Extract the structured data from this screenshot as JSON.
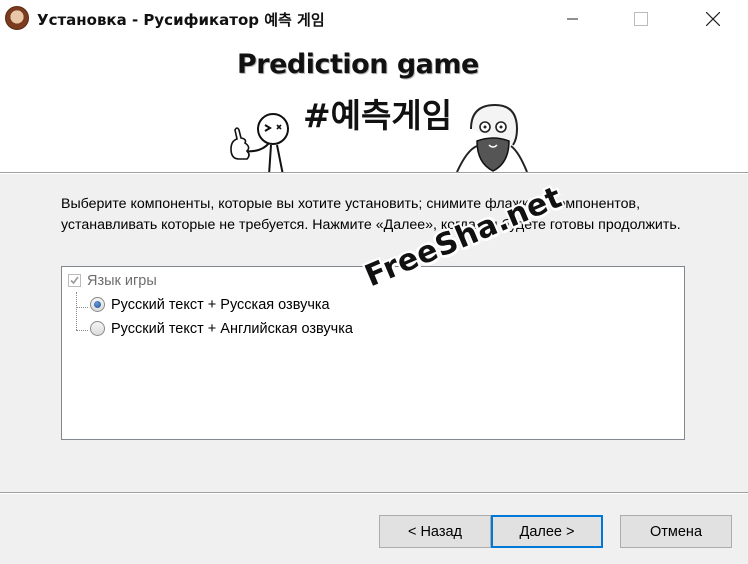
{
  "window": {
    "title": "Установка - Русификатор 예측 게임",
    "controls": {
      "minimize_icon": "minimize-icon",
      "maximize_icon": "maximize-icon",
      "close_icon": "close-icon"
    }
  },
  "banner": {
    "line1": "Prediction game",
    "line2": "#예측게임"
  },
  "description": "Выберите компоненты, которые вы хотите установить; снимите флажки с компонентов, устанавливать которые не требуется. Нажмите «Далее», когда вы будете готовы продолжить.",
  "components": {
    "root": {
      "label": "Язык игры",
      "checked": true,
      "disabled": true
    },
    "options": [
      {
        "label": "Русский текст + Русская озвучка",
        "selected": true
      },
      {
        "label": "Русский текст + Английская озвучка",
        "selected": false
      }
    ]
  },
  "watermark": "FreeSha.net",
  "buttons": {
    "back": "< Назад",
    "next": "Далее >",
    "cancel": "Отмена"
  },
  "colors": {
    "focus_border": "#0078d7",
    "panel_bg": "#f0f0f0"
  }
}
